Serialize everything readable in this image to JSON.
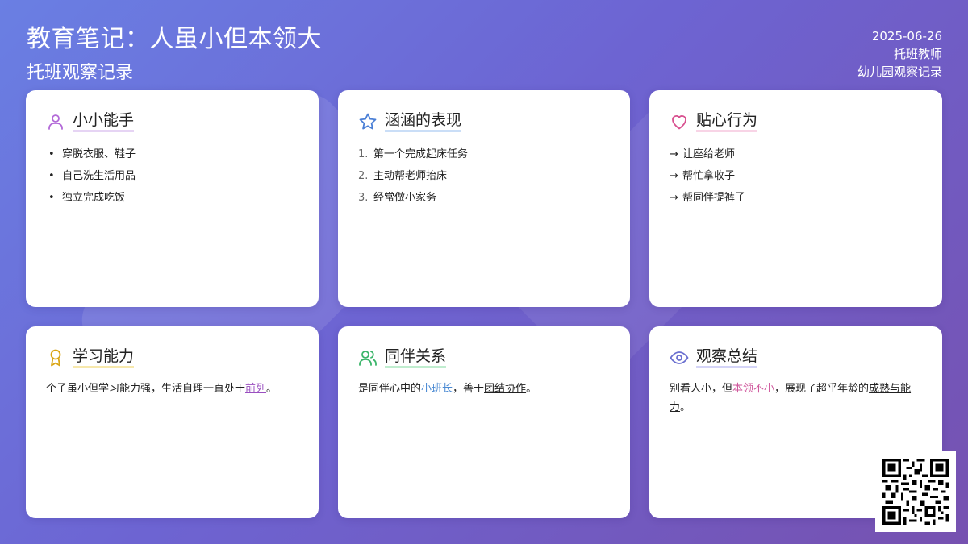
{
  "header": {
    "title": "教育笔记：人虽小但本领大",
    "subtitle": "托班观察记录",
    "date": "2025-06-26",
    "author": "托班教师",
    "category": "幼儿园观察记录"
  },
  "cards": [
    {
      "title": "小小能手",
      "icon": "user-icon",
      "color": "#b36ad8",
      "items": [
        "穿脱衣服、鞋子",
        "自己洗生活用品",
        "独立完成吃饭"
      ]
    },
    {
      "title": "涵涵的表现",
      "icon": "star-icon",
      "color": "#4a7fd6",
      "numbers": [
        "1.",
        "2.",
        "3."
      ],
      "items": [
        "第一个完成起床任务",
        "主动帮老师抬床",
        "经常做小家务"
      ]
    },
    {
      "title": "贴心行为",
      "icon": "heart-icon",
      "color": "#d8508f",
      "arrow": "→",
      "items": [
        "让座给老师",
        "帮忙拿收子",
        "帮同伴提裤子"
      ]
    },
    {
      "title": "学习能力",
      "icon": "award-icon",
      "color": "#d9a514",
      "text_before": "个子虽小但学习能力强，生活自理一直处于",
      "text_highlight": "前列",
      "text_after": "。"
    },
    {
      "title": "同伴关系",
      "icon": "users-icon",
      "color": "#3bb56a",
      "text_1": "是同伴心中的",
      "text_highlight": "小班长",
      "text_2": "，善于",
      "text_underline": "团结协作",
      "text_3": "。"
    },
    {
      "title": "观察总结",
      "icon": "eye-icon",
      "color": "#6a6fd0",
      "text_1": "别看人小，但",
      "text_highlight": "本领不小",
      "text_2": "，展现了超乎年龄的",
      "text_underline": "成熟与能力",
      "text_3": "。"
    }
  ],
  "qr": {
    "icon": "qr-code-icon"
  }
}
